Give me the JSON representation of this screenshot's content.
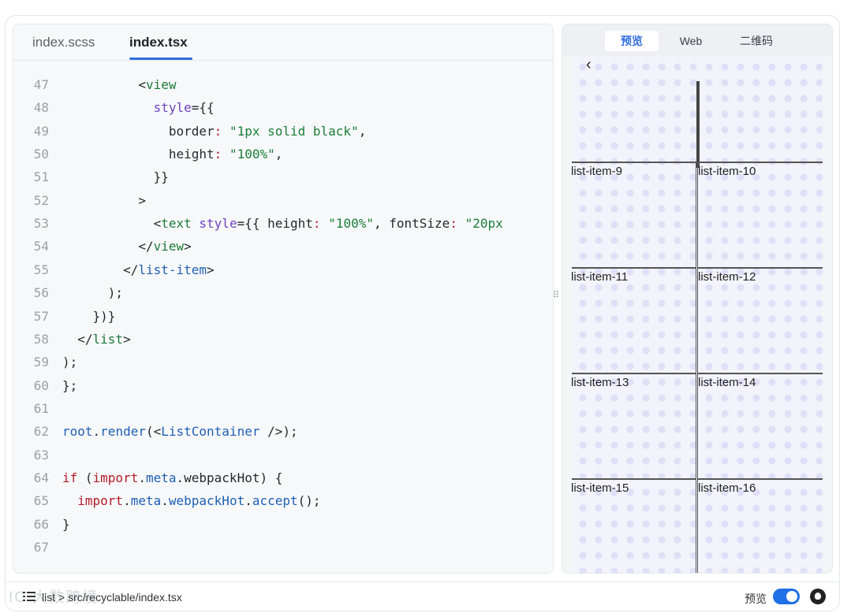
{
  "editor": {
    "tabs": [
      {
        "label": "index.scss",
        "active": false
      },
      {
        "label": "index.tsx",
        "active": true
      }
    ],
    "lines": [
      {
        "n": "47",
        "indent": "          ",
        "html": "<span class=\"prop\">&lt;</span><span class=\"tag\">view</span>"
      },
      {
        "n": "48",
        "indent": "            ",
        "html": "<span class=\"attr\">style</span><span class=\"prop\">={{</span>"
      },
      {
        "n": "49",
        "indent": "              ",
        "html": "<span class=\"prop\">border</span><span class=\"colon\">:</span> <span class=\"str\">\"1px solid black\"</span>,"
      },
      {
        "n": "50",
        "indent": "              ",
        "html": "<span class=\"prop\">height</span><span class=\"colon\">:</span> <span class=\"str\">\"100%\"</span>,"
      },
      {
        "n": "51",
        "indent": "            ",
        "html": "}}"
      },
      {
        "n": "52",
        "indent": "          ",
        "html": "&gt;"
      },
      {
        "n": "53",
        "indent": "            ",
        "html": "&lt;<span class=\"tag\">text</span> <span class=\"attr\">style</span>={{ <span class=\"prop\">height</span><span class=\"colon\">:</span> <span class=\"str\">\"100%\"</span>, <span class=\"prop\">fontSize</span><span class=\"colon\">:</span> <span class=\"str\">\"20px</span>"
      },
      {
        "n": "54",
        "indent": "          ",
        "html": "&lt;/<span class=\"tag\">view</span>&gt;"
      },
      {
        "n": "55",
        "indent": "        ",
        "html": "&lt;/<span class=\"fn\">list-item</span>&gt;"
      },
      {
        "n": "56",
        "indent": "      ",
        "html": ");"
      },
      {
        "n": "57",
        "indent": "    ",
        "html": "})}"
      },
      {
        "n": "58",
        "indent": "  ",
        "html": "&lt;/<span class=\"tag\">list</span>&gt;"
      },
      {
        "n": "59",
        "indent": "",
        "html": ");"
      },
      {
        "n": "60",
        "indent": "",
        "html": "};"
      },
      {
        "n": "61",
        "indent": "",
        "html": ""
      },
      {
        "n": "62",
        "indent": "",
        "html": "<span class=\"fn\">root</span>.<span class=\"fn\">render</span>(&lt;<span class=\"fn\">ListContainer</span> /&gt;);"
      },
      {
        "n": "63",
        "indent": "",
        "html": ""
      },
      {
        "n": "64",
        "indent": "",
        "html": "<span class=\"kw\">if</span> (<span class=\"kw\">import</span>.<span class=\"fn\">meta</span>.webpackHot) {"
      },
      {
        "n": "65",
        "indent": "  ",
        "html": "<span class=\"kw\">import</span>.<span class=\"fn\">meta</span>.<span class=\"fn\">webpackHot</span>.<span class=\"fn\">accept</span>();"
      },
      {
        "n": "66",
        "indent": "",
        "html": "}"
      },
      {
        "n": "67",
        "indent": "",
        "html": ""
      }
    ]
  },
  "preview": {
    "tabs": [
      {
        "label": "预览",
        "active": true
      },
      {
        "label": "Web",
        "active": false
      },
      {
        "label": "二维码",
        "active": false
      }
    ],
    "back_icon": "chevron-left-icon",
    "items": [
      [
        "list-item-9",
        "list-item-10"
      ],
      [
        "list-item-11",
        "list-item-12"
      ],
      [
        "list-item-13",
        "list-item-14"
      ],
      [
        "list-item-15",
        "list-item-16"
      ]
    ]
  },
  "footer": {
    "watermark": "IC 大数跨境",
    "breadcrumb": "list > src/recyclable/index.tsx",
    "toggle_label": "预览",
    "toggle_on": true,
    "menu_icon": "list-menu-icon",
    "github_icon": "github-icon"
  }
}
